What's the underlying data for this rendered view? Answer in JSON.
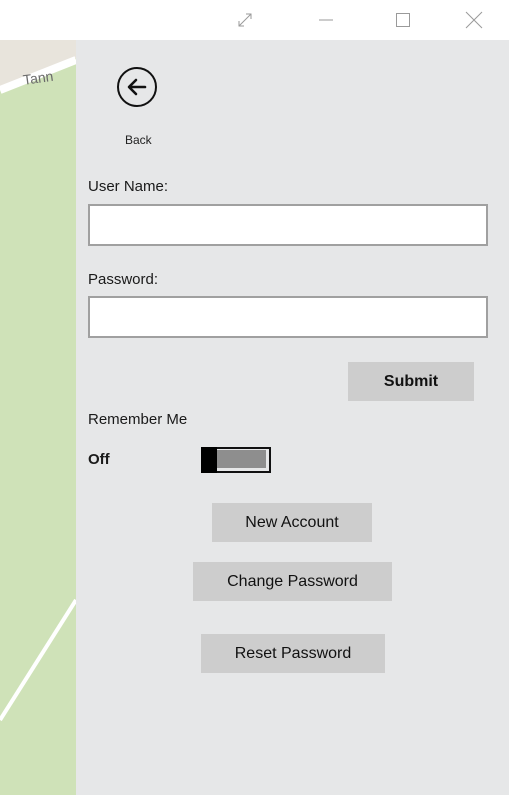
{
  "window": {
    "fullscreen_icon": "expand-diagonal-icon",
    "minimize_icon": "minimize-icon",
    "maximize_icon": "maximize-icon",
    "close_icon": "close-icon"
  },
  "map": {
    "street_label": "Tann",
    "colors": {
      "park": "#cfe2b8",
      "road": "#ffffff",
      "ground": "#e8e4dc"
    }
  },
  "back": {
    "label": "Back",
    "icon": "back-arrow-icon"
  },
  "form": {
    "username_label": "User Name:",
    "username_value": "",
    "password_label": "Password:",
    "password_value": "",
    "submit_label": "Submit"
  },
  "remember": {
    "label": "Remember Me",
    "state_label": "Off",
    "on": false
  },
  "actions": {
    "new_account": "New Account",
    "change_password": "Change Password",
    "reset_password": "Reset Password"
  },
  "colors": {
    "panel_bg": "#e6e7e8",
    "button_bg": "#cdcdcd",
    "input_border": "#a0a0a0"
  }
}
